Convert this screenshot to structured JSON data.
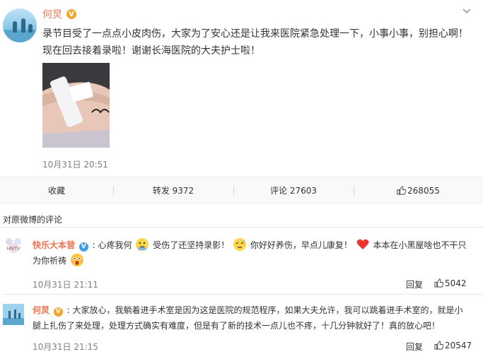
{
  "post": {
    "author": "何炅",
    "verified_mark": "V",
    "text": "录节目受了一点点小皮肉伤，大家为了安心还是让我来医院紧急处理一下，小事小事，别担心啊！现在回去接着录啦！谢谢长海医院的大夫护士啦！",
    "timestamp": "10月31日 20:51",
    "menu_icon": "chevron-down-icon",
    "accent_color": "#eb7350"
  },
  "actions": {
    "favorite": "收藏",
    "repost": "转发 9372",
    "comment": "评论 27603",
    "like": "268055"
  },
  "comments_section": {
    "title": "对原微博的评论"
  },
  "comments": [
    {
      "author": "快乐大本营",
      "verified_mark": "V",
      "text_parts": [
        ": 心疼我何",
        "受伤了还坚持录影！",
        "你好好养伤，早点儿康复！",
        "本本在小黑屋啥也不干只为你祈祷"
      ],
      "emojis": [
        "sad-face-emoji",
        "sweat-face-emoji",
        "heart-emoji",
        "shocked-face-emoji"
      ],
      "timestamp": "10月31日 21:11",
      "reply": "回复",
      "likes": "5042"
    },
    {
      "author": "何炅",
      "verified_mark": "V",
      "text": ": 大家放心，我躺着进手术室是因为这是医院的规范程序，如果大夫允许，我可以跳着进手术室的，就是小腿上扎伤了来处理，处理方式确实有难度，但是有了新的技术一点儿也不疼，十几分钟就好了！真的放心吧！",
      "timestamp": "10月31日 21:15",
      "reply": "回复",
      "likes": "20547"
    }
  ]
}
